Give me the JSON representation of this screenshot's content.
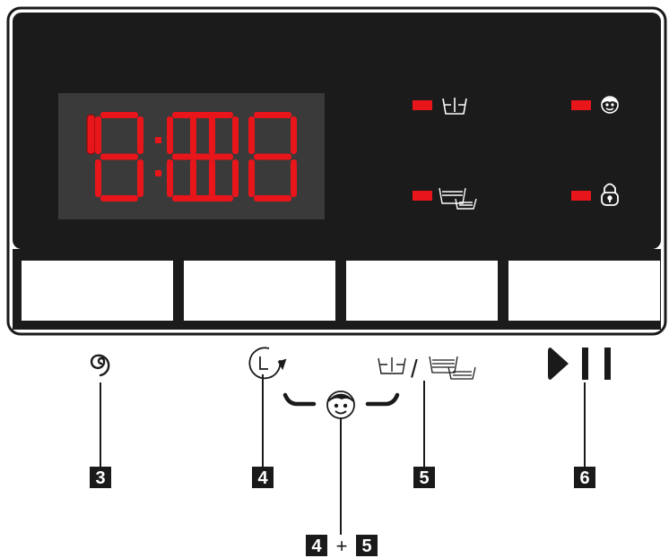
{
  "display": {
    "digits": [
      "1",
      "8",
      "8",
      "8",
      "8"
    ],
    "separator": ":"
  },
  "indicators": [
    {
      "name": "rinse-hold"
    },
    {
      "name": "child-lock"
    },
    {
      "name": "extra-rinse"
    },
    {
      "name": "door-lock"
    }
  ],
  "callouts": {
    "spin": "3",
    "delay": "4",
    "rinse": "5",
    "start": "6",
    "combo_left": "4",
    "combo_plus": "+",
    "combo_right": "5"
  },
  "separator_slash": "/",
  "colors": {
    "panel": "#1b1b1b",
    "display_bg": "#3a3a3a",
    "led": "#e8151b",
    "segment_on": "#e8151b",
    "segment_off": "#4b4b4b",
    "button_face": "#ffffff",
    "outline": "#1a1a1a",
    "icon": "#1a1a1a"
  }
}
